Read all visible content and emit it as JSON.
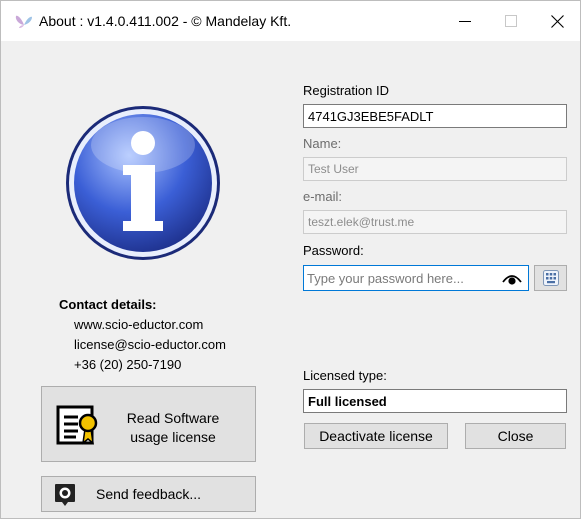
{
  "window": {
    "title": "About : v1.4.0.411.002 - © Mandelay Kft.",
    "controls": {
      "minimize": "—",
      "maximize": "☐",
      "close": "✕"
    }
  },
  "icons": {
    "app": "butterfly-logo-icon",
    "info": "info-icon",
    "license": "license-certificate-icon",
    "feedback": "feedback-chat-icon",
    "reveal_password": "eye-icon",
    "keyboard": "on-screen-keyboard-icon"
  },
  "colors": {
    "focus_border": "#0078d7",
    "info_blue": "#3b5fd6",
    "window_bg": "#f0f0f0"
  },
  "contact": {
    "label": "Contact details:",
    "website": "www.scio-eductor.com",
    "email": "license@scio-eductor.com",
    "phone": "+36 (20) 250-7190"
  },
  "buttons": {
    "read_license": "Read Software usage license",
    "feedback": "Send feedback...",
    "deactivate": "Deactivate license",
    "close": "Close"
  },
  "form": {
    "registration_id_label": "Registration ID",
    "registration_id_value": "4741GJ3EBE5FADLT",
    "name_label": "Name:",
    "name_value": "Test User",
    "email_label": "e-mail:",
    "email_value": "teszt.elek@trust.me",
    "password_label": "Password:",
    "password_value": "",
    "password_placeholder": "Type your password here...",
    "licensed_type_label": "Licensed type:",
    "licensed_type_value": "Full licensed"
  }
}
